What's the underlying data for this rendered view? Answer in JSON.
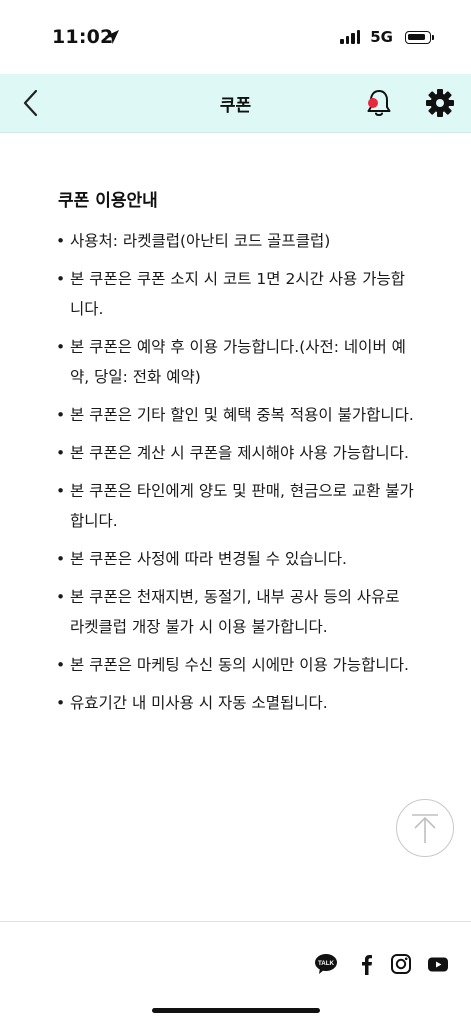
{
  "status_bar": {
    "time": "11:02",
    "network": "5G"
  },
  "header": {
    "title": "쿠폰"
  },
  "content": {
    "section_title": "쿠폰 이용안내",
    "items": [
      "사용처: 라켓클럽(아난티 코드 골프클럽)",
      "본 쿠폰은 쿠폰 소지 시 코트 1면 2시간 사용 가능합니다.",
      "본 쿠폰은 예약 후 이용 가능합니다.(사전: 네이버 예약, 당일: 전화 예약)",
      "본 쿠폰은 기타 할인 및 혜택 중복 적용이 불가합니다.",
      "본 쿠폰은 계산 시 쿠폰을 제시해야 사용 가능합니다.",
      "본 쿠폰은 타인에게 양도 및 판매, 현금으로 교환 불가합니다.",
      "본 쿠폰은 사정에 따라 변경될 수 있습니다.",
      "본 쿠폰은 천재지변, 동절기, 내부 공사 등의 사유로 라켓클럽 개장 불가 시 이용 불가합니다.",
      "본 쿠폰은 마케팅 수신 동의 시에만 이용 가능합니다.",
      "유효기간 내 미사용 시 자동 소멸됩니다."
    ]
  },
  "footer": {
    "talk_label": "TALK",
    "social_icons": [
      "kakaotalk-icon",
      "facebook-icon",
      "instagram-icon",
      "youtube-icon"
    ]
  },
  "colors": {
    "header_bg": "#ddf8f5",
    "notification_dot": "#e8283c"
  }
}
